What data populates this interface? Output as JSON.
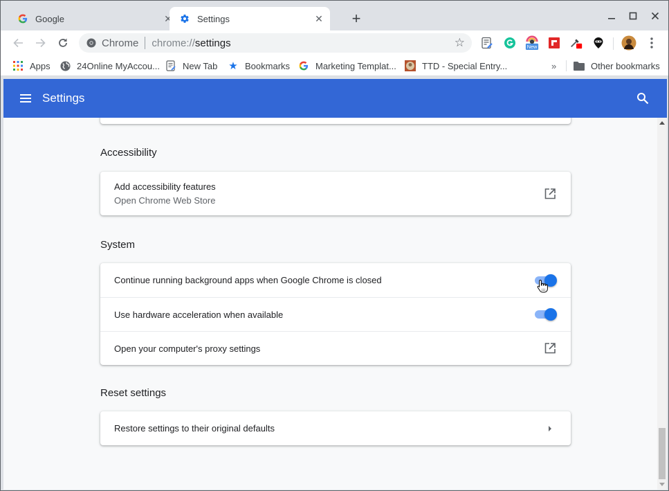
{
  "window": {
    "controls": {
      "minimize": "minimize-icon",
      "maximize": "maximize-icon",
      "close": "close-icon"
    }
  },
  "tabs": [
    {
      "title": "Google",
      "icon": "google-g-icon",
      "active": false
    },
    {
      "title": "Settings",
      "icon": "gear-icon",
      "active": true
    }
  ],
  "toolbar": {
    "omnibox": {
      "chip": "Chrome",
      "scheme": "chrome://",
      "host": "settings"
    },
    "extensions": [
      {
        "name": "notes-extension-icon"
      },
      {
        "name": "grammarly-icon"
      },
      {
        "name": "screenshot-extension-icon",
        "badge": "New"
      },
      {
        "name": "flipboard-icon"
      },
      {
        "name": "eyedropper-icon"
      },
      {
        "name": "ninja-icon"
      }
    ],
    "profile": "profile-avatar",
    "menu": "more-vertical-icon"
  },
  "bookmarks": {
    "items": [
      {
        "label": "Apps",
        "icon": "apps-grid-icon"
      },
      {
        "label": "24Online MyAccou...",
        "icon": "globe-icon"
      },
      {
        "label": "New Tab",
        "icon": "page-icon"
      },
      {
        "label": "Bookmarks",
        "icon": "star-icon"
      },
      {
        "label": "Marketing Templat...",
        "icon": "google-g-icon"
      },
      {
        "label": "TTD - Special Entry...",
        "icon": "ttd-icon"
      }
    ],
    "overflow": "»",
    "other": "Other bookmarks"
  },
  "header": {
    "title": "Settings"
  },
  "sections": {
    "accessibility": {
      "title": "Accessibility",
      "rows": [
        {
          "label": "Add accessibility features",
          "sublabel": "Open Chrome Web Store"
        }
      ]
    },
    "system": {
      "title": "System",
      "rows": [
        {
          "label": "Continue running background apps when Google Chrome is closed",
          "toggle": true
        },
        {
          "label": "Use hardware acceleration when available",
          "toggle": true
        },
        {
          "label": "Open your computer's proxy settings"
        }
      ]
    },
    "reset": {
      "title": "Reset settings",
      "rows": [
        {
          "label": "Restore settings to their original defaults"
        }
      ]
    }
  },
  "colors": {
    "header_bg": "#3367d6",
    "toggle_on": "#1a73e8",
    "toggle_track": "#8ab4f8",
    "content_bg": "#f8f9fa"
  }
}
